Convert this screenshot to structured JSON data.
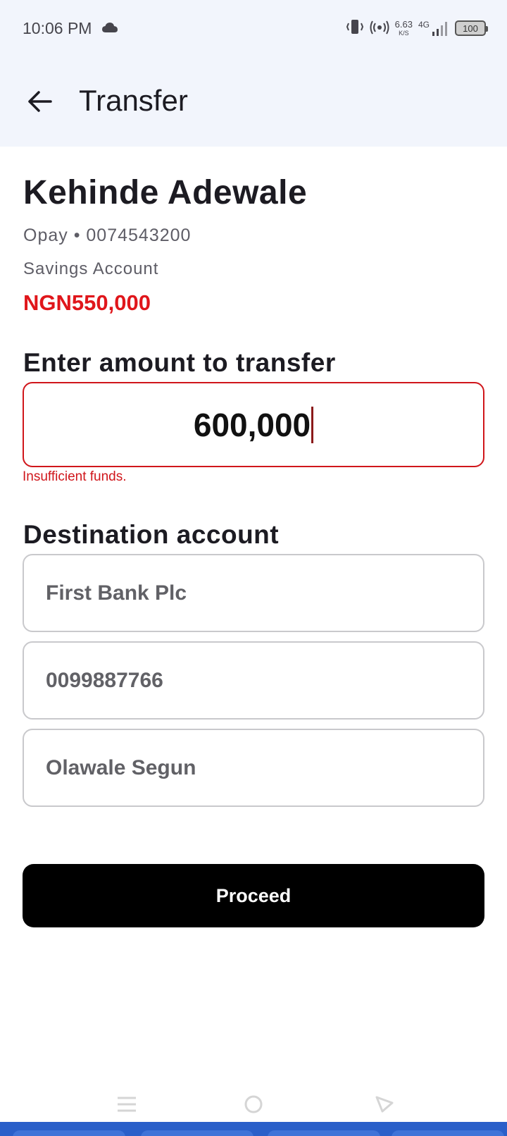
{
  "status_bar": {
    "time": "10:06 PM",
    "net_speed_value": "6.63",
    "net_speed_unit": "K/S",
    "network": "4G",
    "battery": "100"
  },
  "app_bar": {
    "title": "Transfer"
  },
  "account": {
    "name": "Kehinde Adewale",
    "bank_and_number": "Opay • 0074543200",
    "type": "Savings Account",
    "balance": "NGN550,000",
    "balance_color": "#e0161b"
  },
  "amount": {
    "label": "Enter amount to transfer",
    "value": "600,000",
    "error": "Insufficient funds.",
    "error_color": "#d0161b"
  },
  "destination": {
    "label": "Destination account",
    "bank": "First Bank Plc",
    "account_number": "0099887766",
    "account_name": "Olawale Segun"
  },
  "actions": {
    "proceed_label": "Proceed"
  },
  "nav": {
    "menu_icon": "menu-icon",
    "home_icon": "home-circle-icon",
    "back_icon": "back-triangle-icon"
  }
}
